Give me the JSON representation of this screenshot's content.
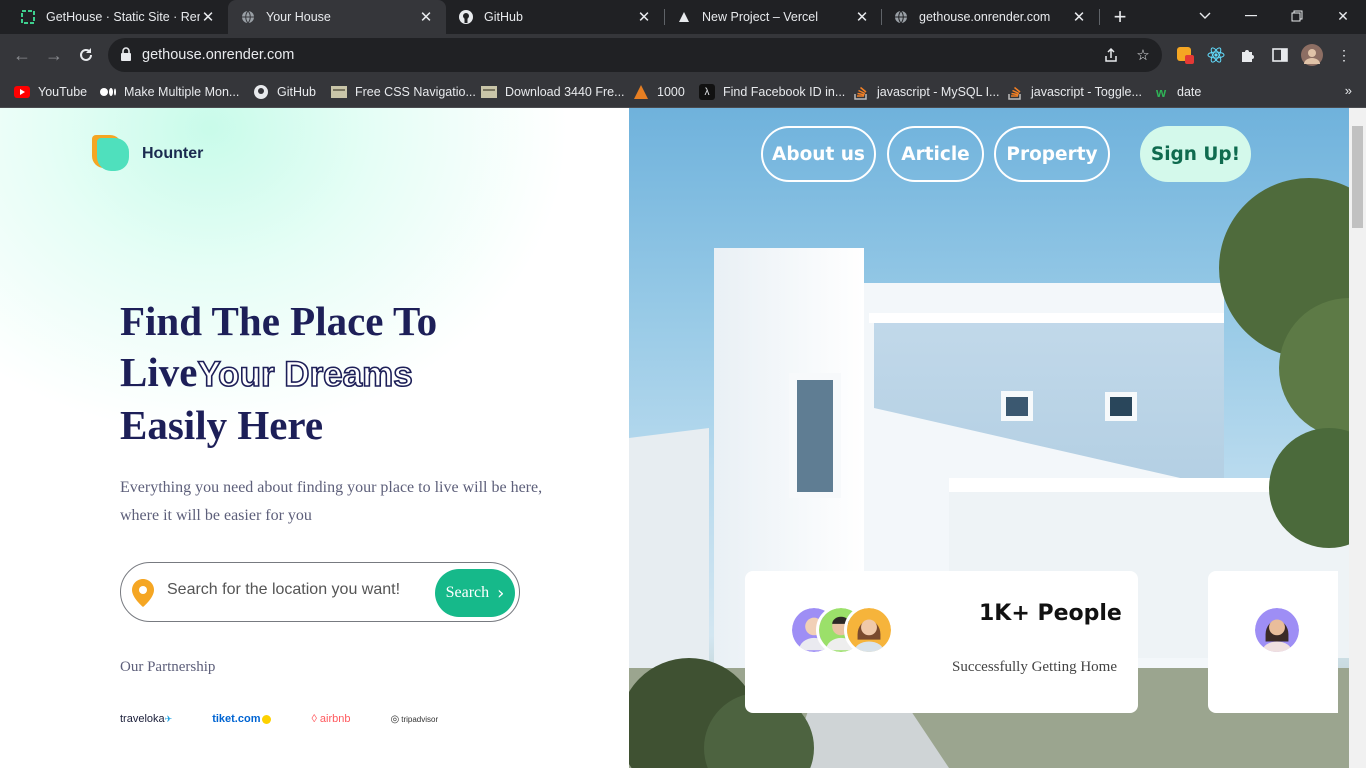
{
  "browser": {
    "tabs": [
      {
        "label": "GetHouse · Static Site · Render",
        "active": false,
        "icon": "render-icon"
      },
      {
        "label": "Your House",
        "active": true,
        "icon": "globe-icon"
      },
      {
        "label": "GitHub",
        "active": false,
        "icon": "github-icon"
      },
      {
        "label": "New Project – Vercel",
        "active": false,
        "icon": "vercel-icon"
      },
      {
        "label": "gethouse.onrender.com",
        "active": false,
        "icon": "globe-icon"
      }
    ],
    "url": "gethouse.onrender.com",
    "bookmarks": [
      {
        "label": "YouTube",
        "icon": "youtube-icon"
      },
      {
        "label": "Make Multiple Mon...",
        "icon": "medium-icon"
      },
      {
        "label": "GitHub",
        "icon": "github-icon"
      },
      {
        "label": "Free CSS Navigatio...",
        "icon": "page-icon"
      },
      {
        "label": "Download 3440 Fre...",
        "icon": "page-icon"
      },
      {
        "label": "1000",
        "icon": "pdf-icon"
      },
      {
        "label": "Find Facebook ID in...",
        "icon": "lambda-icon"
      },
      {
        "label": "javascript - MySQL I...",
        "icon": "stackoverflow-icon"
      },
      {
        "label": "javascript - Toggle...",
        "icon": "stackoverflow-icon"
      },
      {
        "label": "date",
        "icon": "w-icon"
      }
    ],
    "more_label": "»"
  },
  "site": {
    "brand": "Hounter",
    "nav": [
      "About us",
      "Article",
      "Property"
    ],
    "signup": "Sign Up!",
    "hero": {
      "line1": "Find The Place To",
      "line2a": "Live",
      "line2b": "Your Dreams",
      "line3": "Easily Here"
    },
    "subtitle": "Everything you need about finding your place to live will be here, where it will be easier for you",
    "search": {
      "placeholder": "Search for the location you want!",
      "button": "Search"
    },
    "partnership_title": "Our Partnership",
    "partners": [
      "traveloka",
      "tiket.com",
      "airbnb",
      "tripadvisor"
    ],
    "stats_card": {
      "title": "1K+ People",
      "subtitle": "Successfully Getting Home"
    }
  },
  "colors": {
    "brand_green": "#16b98a",
    "heading_navy": "#1d1f58",
    "signup_bg": "#d4f9eb"
  }
}
